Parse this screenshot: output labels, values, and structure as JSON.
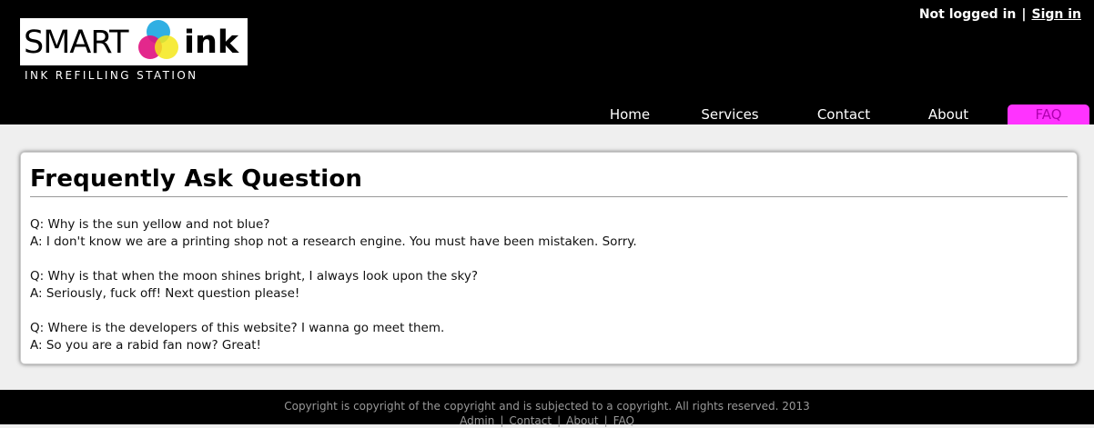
{
  "header": {
    "login_status": "Not logged in",
    "separator": "|",
    "sign_in": "Sign in"
  },
  "logo": {
    "smart": "SMART",
    "ink": "ink",
    "tagline": "INK REFILLING STATION",
    "colors": [
      "#1aa6e0",
      "#e0117f",
      "#f5e71a"
    ]
  },
  "nav": {
    "items": [
      {
        "label": "Home"
      },
      {
        "label": "Services"
      },
      {
        "label": "Contact"
      },
      {
        "label": "About"
      },
      {
        "label": "FAQ",
        "active": true
      }
    ],
    "active_color": "#ff33ff"
  },
  "main": {
    "title": "Frequently Ask Question",
    "faqs": [
      {
        "q": "Q: Why is the sun yellow and not blue?",
        "a": "A: I don't know we are a printing shop not a research engine. You must have been mistaken. Sorry."
      },
      {
        "q": "Q: Why is that when the moon shines bright, I always look upon the sky?",
        "a": "A: Seriously, fuck off! Next question please!"
      },
      {
        "q": "Q: Where is the developers of this website? I wanna go meet them.",
        "a": "A: So you are a rabid fan now? Great!"
      }
    ]
  },
  "footer": {
    "copyright": "Copyright is copyright of the copyright and is subjected to a copyright. All rights reserved. 2013",
    "links": [
      "Admin",
      "Contact",
      "About",
      "FAQ"
    ],
    "separator": "|"
  }
}
